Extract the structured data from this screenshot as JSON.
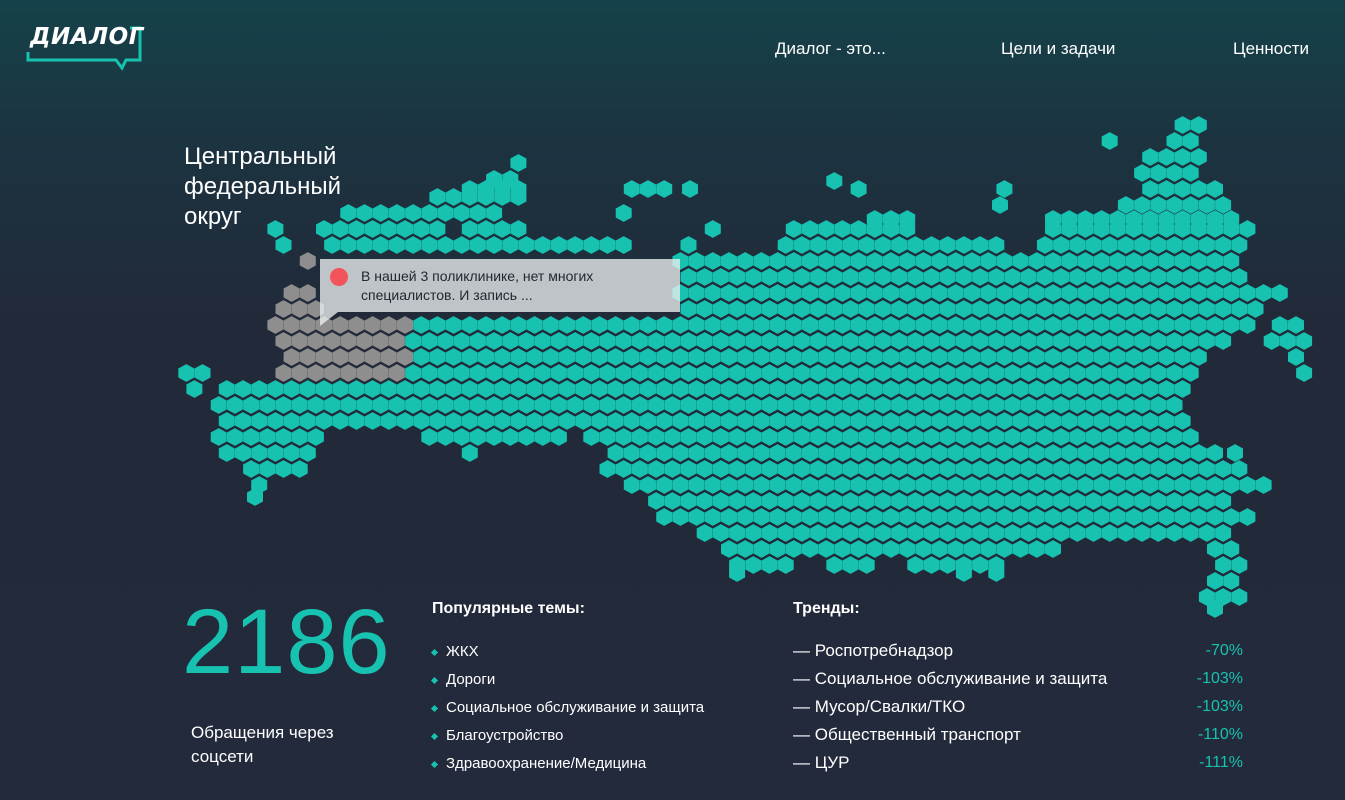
{
  "logo": {
    "text": "ДИАЛОГ"
  },
  "nav": {
    "items": [
      "Диалог - это...",
      "Цели и задачи",
      "Ценности"
    ]
  },
  "colors": {
    "accent": "#18c2b0",
    "hex_default": "#18c2b0",
    "hex_selected": "#8e8e8e",
    "marker": "#f2545b",
    "background": "#232a3b"
  },
  "map": {
    "region_title": "Центральный федеральный округ",
    "tooltip": {
      "icon": "dot-icon",
      "text": "В нашей 3 поликлинике, нет многих специалистов. И запись ..."
    }
  },
  "stats": {
    "count": "2186",
    "caption": "Обращения через соцсети"
  },
  "topics": {
    "title": "Популярные темы:",
    "items": [
      "ЖКХ",
      "Дороги",
      "Социальное обслуживание и защита",
      "Благоустройство",
      "Здравоохранение/Медицина"
    ]
  },
  "trends": {
    "title": "Тренды:",
    "items": [
      {
        "dash": "—",
        "name": "Роспотребнадзор",
        "value": "-70%"
      },
      {
        "dash": "—",
        "name": "Социальное обслуживание и защита",
        "value": "-103%"
      },
      {
        "dash": "—",
        "name": "Мусор/Свалки/ТКО",
        "value": "-103%"
      },
      {
        "dash": "—",
        "name": "Общественный транспорт",
        "value": "-110%"
      },
      {
        "dash": "—",
        "name": "ЦУР",
        "value": "-111%"
      }
    ]
  }
}
